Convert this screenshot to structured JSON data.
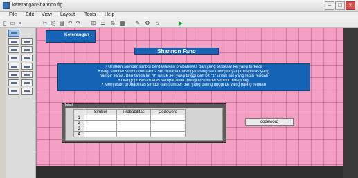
{
  "window": {
    "title": "keteranganShannon.fig"
  },
  "menu": [
    "File",
    "Edit",
    "View",
    "Layout",
    "Tools",
    "Help"
  ],
  "toolbar_icons": [
    "new-icon",
    "open-icon",
    "save-icon",
    "cut-icon",
    "copy-icon",
    "paste-icon",
    "undo-icon",
    "redo-icon",
    "align-icon",
    "menu-editor-icon",
    "tab-order-icon",
    "toolbar-editor-icon",
    "mfile-editor-icon",
    "property-inspector-icon",
    "object-browser-icon",
    "run-icon"
  ],
  "palette_icons": [
    "select-tool",
    "pushbutton-tool",
    "slider-tool",
    "radiobutton-tool",
    "checkbox-tool",
    "edit-text-tool",
    "static-text-tool",
    "popup-menu-tool",
    "listbox-tool",
    "toggle-button-tool",
    "table-tool",
    "axes-tool",
    "panel-tool",
    "button-group-tool",
    "activex-tool"
  ],
  "keterangan_label": "Keterangan :",
  "heading": "Shannon Fano",
  "description_lines": [
    "• Urutkan sumber simbol berdasarkan probabilitas dari yang terbesar ke yang terkecil",
    "• Bagi sumber simbol menjadi 2 set dimana masing-masing set mempunyai probabilitas yang",
    "hampir sama. Beri tanda bit \"0\" untuk set yang tinggi dan bit \"1\" untuk set yang lebih rendah",
    "• Ulangi proses di atas sampai tidak mungkin sumber simbol dibagi lagi",
    "• Menyusun probabilitas simbol dari sumber dari yang paling tinggi ke yang paling rendah"
  ],
  "panel": {
    "title": "Tabel"
  },
  "table": {
    "columns": [
      "Simbol",
      "Probabilitas",
      "Codeword"
    ],
    "rows": [
      "1",
      "2",
      "3",
      "4"
    ]
  },
  "codeword_button": "codeword",
  "colors": {
    "canvas": "#f4a0c4",
    "accent": "#1463b4"
  }
}
